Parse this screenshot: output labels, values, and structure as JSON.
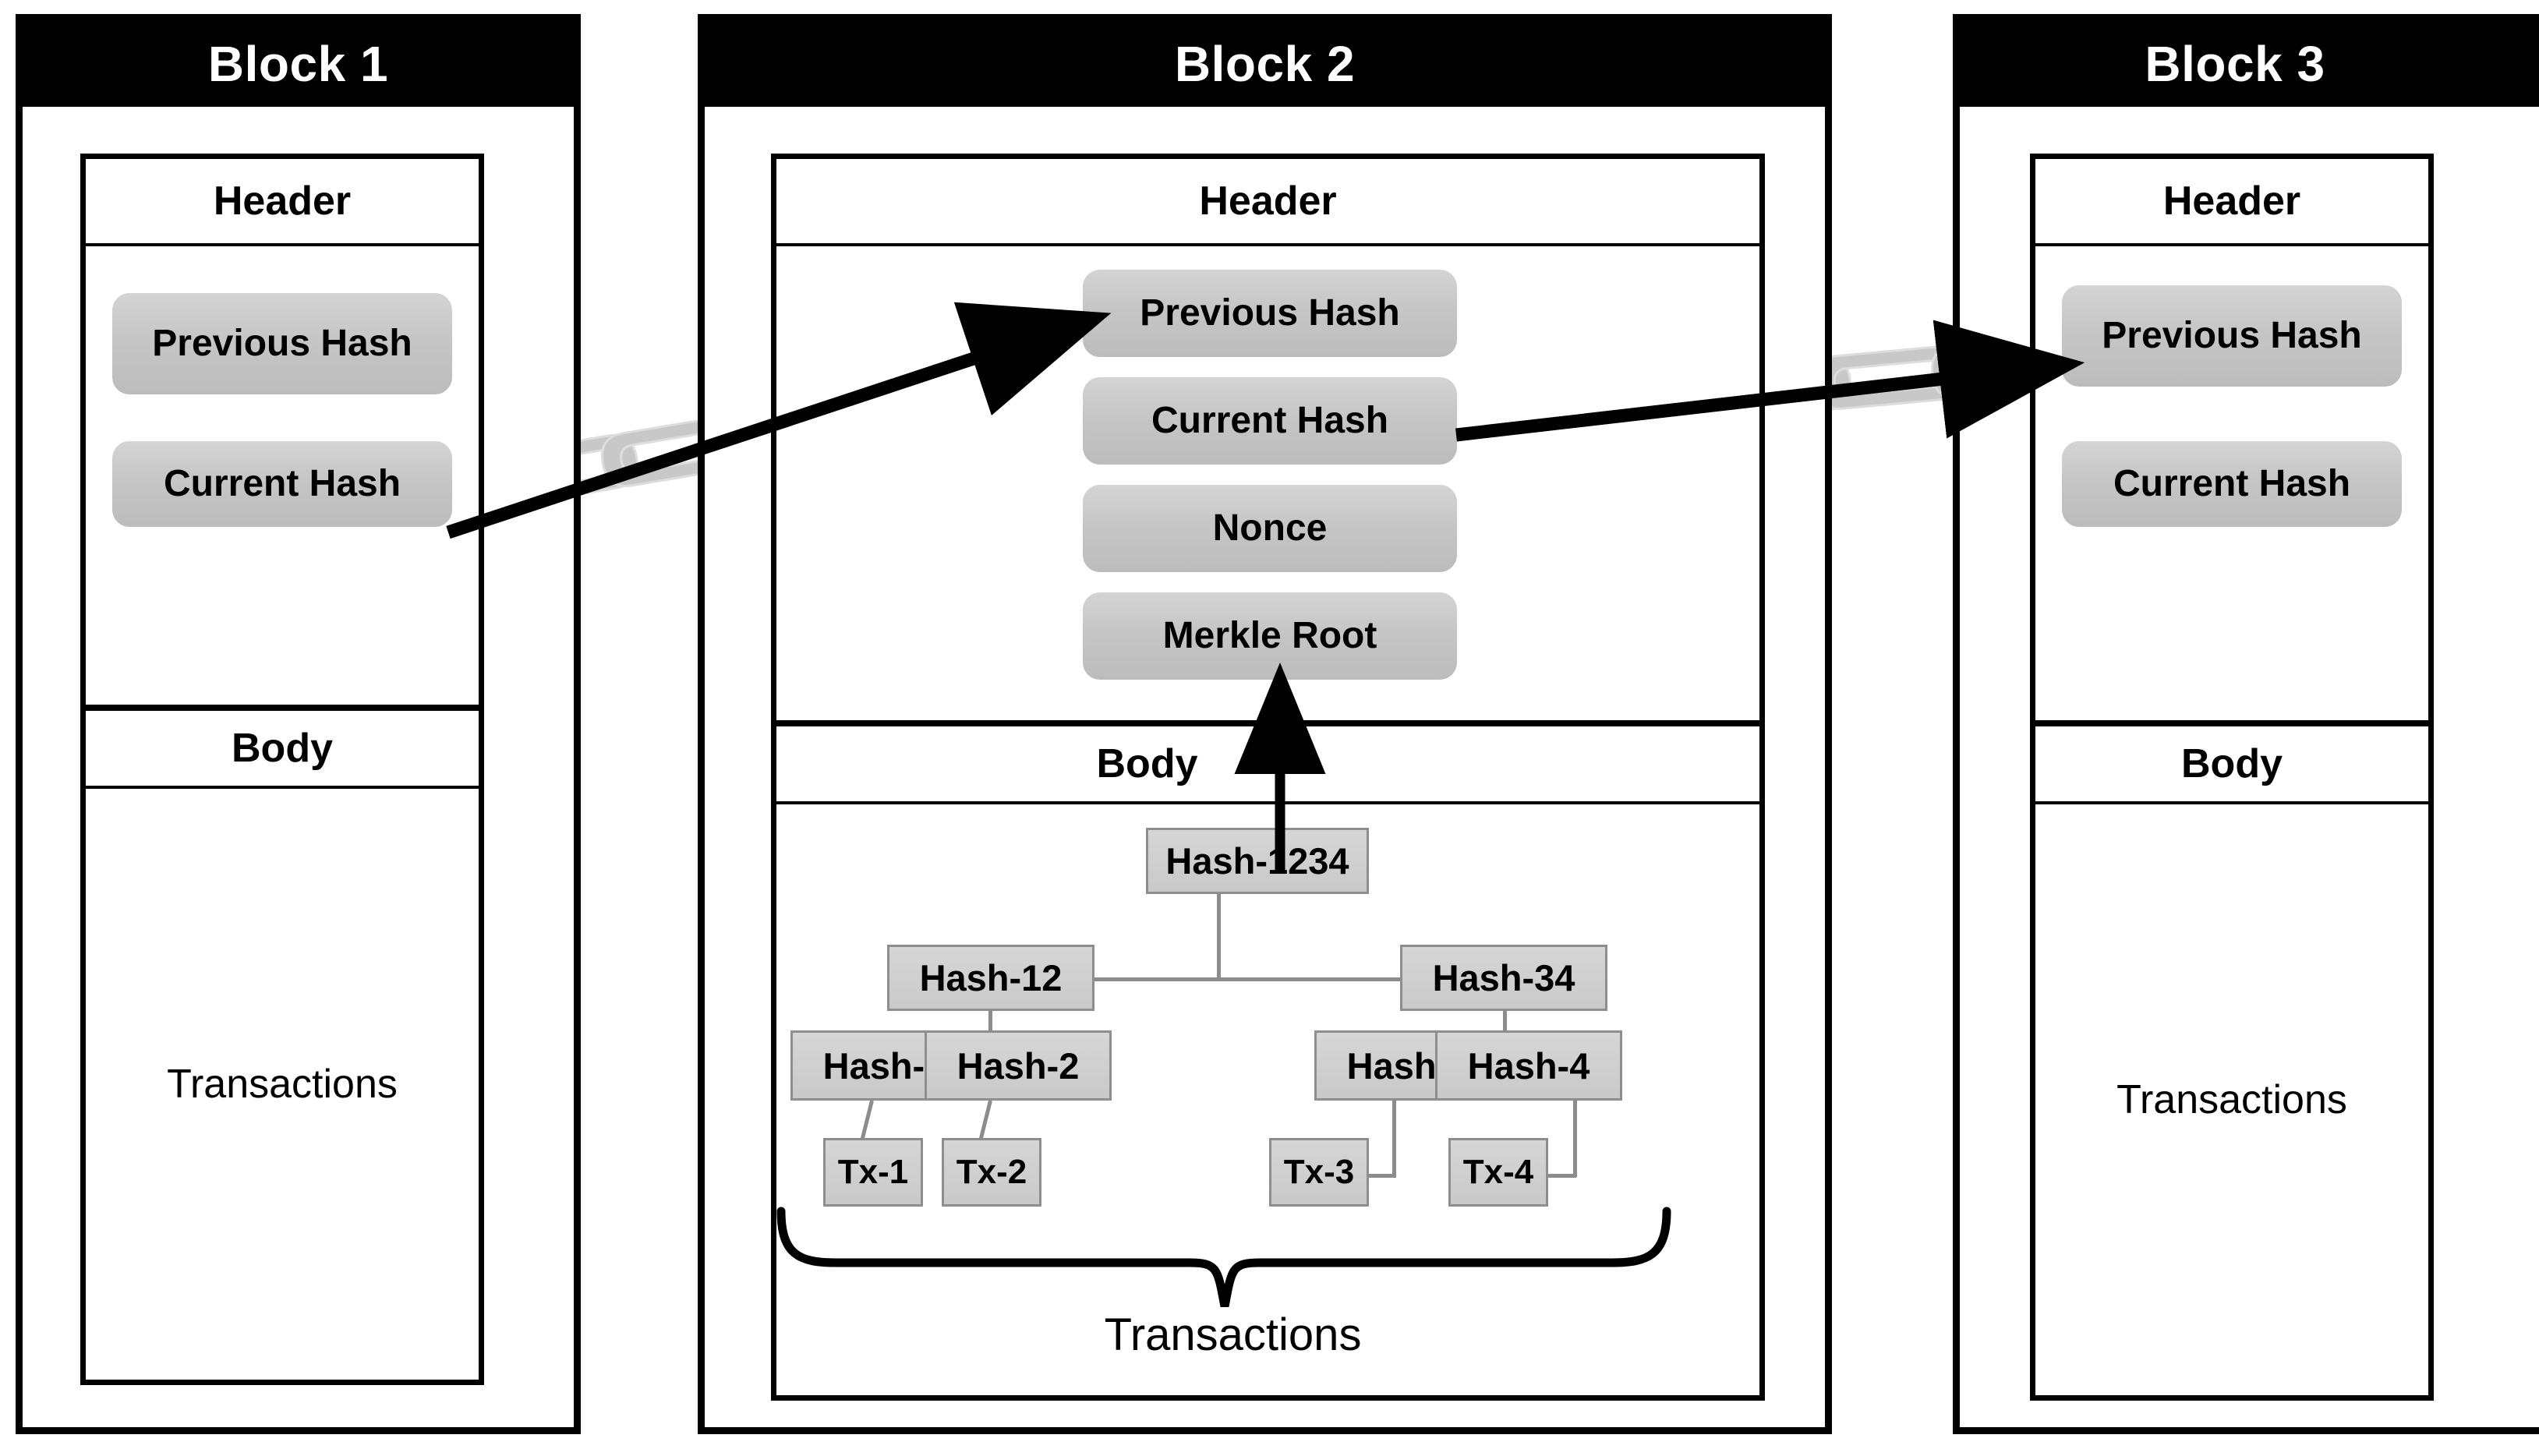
{
  "diagram": {
    "title_block1": "Block 1",
    "title_block2": "Block 2",
    "title_block3": "Block 3",
    "section_header": "Header",
    "section_body": "Body",
    "body_placeholder": "Transactions",
    "transactions_label": "Transactions",
    "colors": {
      "title_bar": "#000000",
      "title_text": "#ffffff",
      "pill_fill": "#c6c6c6",
      "merkle_fill": "#cdcdcd",
      "merkle_border": "#8e8e8e",
      "chain_link": "#c8c8c8",
      "arrow": "#000000",
      "outline": "#000000",
      "page_background": "#ffffff"
    }
  },
  "blocks": [
    {
      "id": "block-1",
      "title": "Block 1",
      "header_label": "Header",
      "body_label": "Body",
      "body_text": "Transactions",
      "header_fields": [
        "Previous Hash",
        "Current Hash"
      ],
      "has_merkle_tree": false
    },
    {
      "id": "block-2",
      "title": "Block 2",
      "header_label": "Header",
      "body_label": "Body",
      "body_text": "Transactions",
      "header_fields": [
        "Previous Hash",
        "Current Hash",
        "Nonce",
        "Merkle Root"
      ],
      "has_merkle_tree": true
    },
    {
      "id": "block-3",
      "title": "Block 3",
      "header_label": "Header",
      "body_label": "Body",
      "body_text": "Transactions",
      "header_fields": [
        "Previous Hash",
        "Current Hash"
      ],
      "has_merkle_tree": false
    }
  ],
  "block1_header": {
    "previous_hash": "Previous Hash",
    "current_hash": "Current Hash"
  },
  "block2_header": {
    "previous_hash": "Previous Hash",
    "current_hash": "Current Hash",
    "nonce": "Nonce",
    "merkle_root": "Merkle Root"
  },
  "block3_header": {
    "previous_hash": "Previous Hash",
    "current_hash": "Current Hash"
  },
  "merkle_tree": {
    "root": "Hash-1234",
    "level2": [
      "Hash-12",
      "Hash-34"
    ],
    "level3": [
      "Hash-1",
      "Hash-2",
      "Hash-3",
      "Hash-4"
    ],
    "transactions": [
      "Tx-1",
      "Tx-2",
      "Tx-3",
      "Tx-4"
    ],
    "brace_label": "Transactions"
  },
  "chain_links": {
    "link_1_to_2": "chain-link-icon",
    "link_2_to_3": "chain-link-icon",
    "arrow_1_to_2": "arrow-right-icon",
    "arrow_2_to_3": "arrow-right-icon",
    "merkle_root_arrow": "arrow-up-icon"
  }
}
